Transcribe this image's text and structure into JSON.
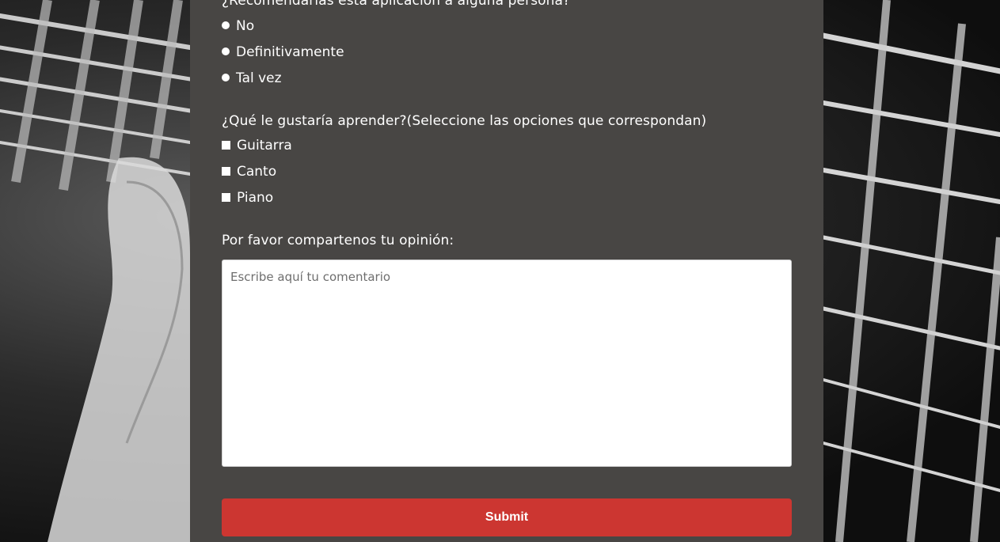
{
  "survey": {
    "recommend": {
      "question": "¿Recomendarías esta aplicación a alguna persona?",
      "options": [
        "No",
        "Definitivamente",
        "Tal vez"
      ]
    },
    "learn": {
      "question": "¿Qué le gustaría aprender?(Seleccione las opciones que correspondan)",
      "options": [
        "Guitarra",
        "Canto",
        "Piano"
      ]
    },
    "opinion": {
      "question": "Por favor compartenos tu opinión:",
      "placeholder": "Escribe aquí tu comentario",
      "value": ""
    },
    "submit_label": "Submit"
  },
  "colors": {
    "panel": "#484644",
    "submit": "#cc3631",
    "text": "#ffffff"
  }
}
